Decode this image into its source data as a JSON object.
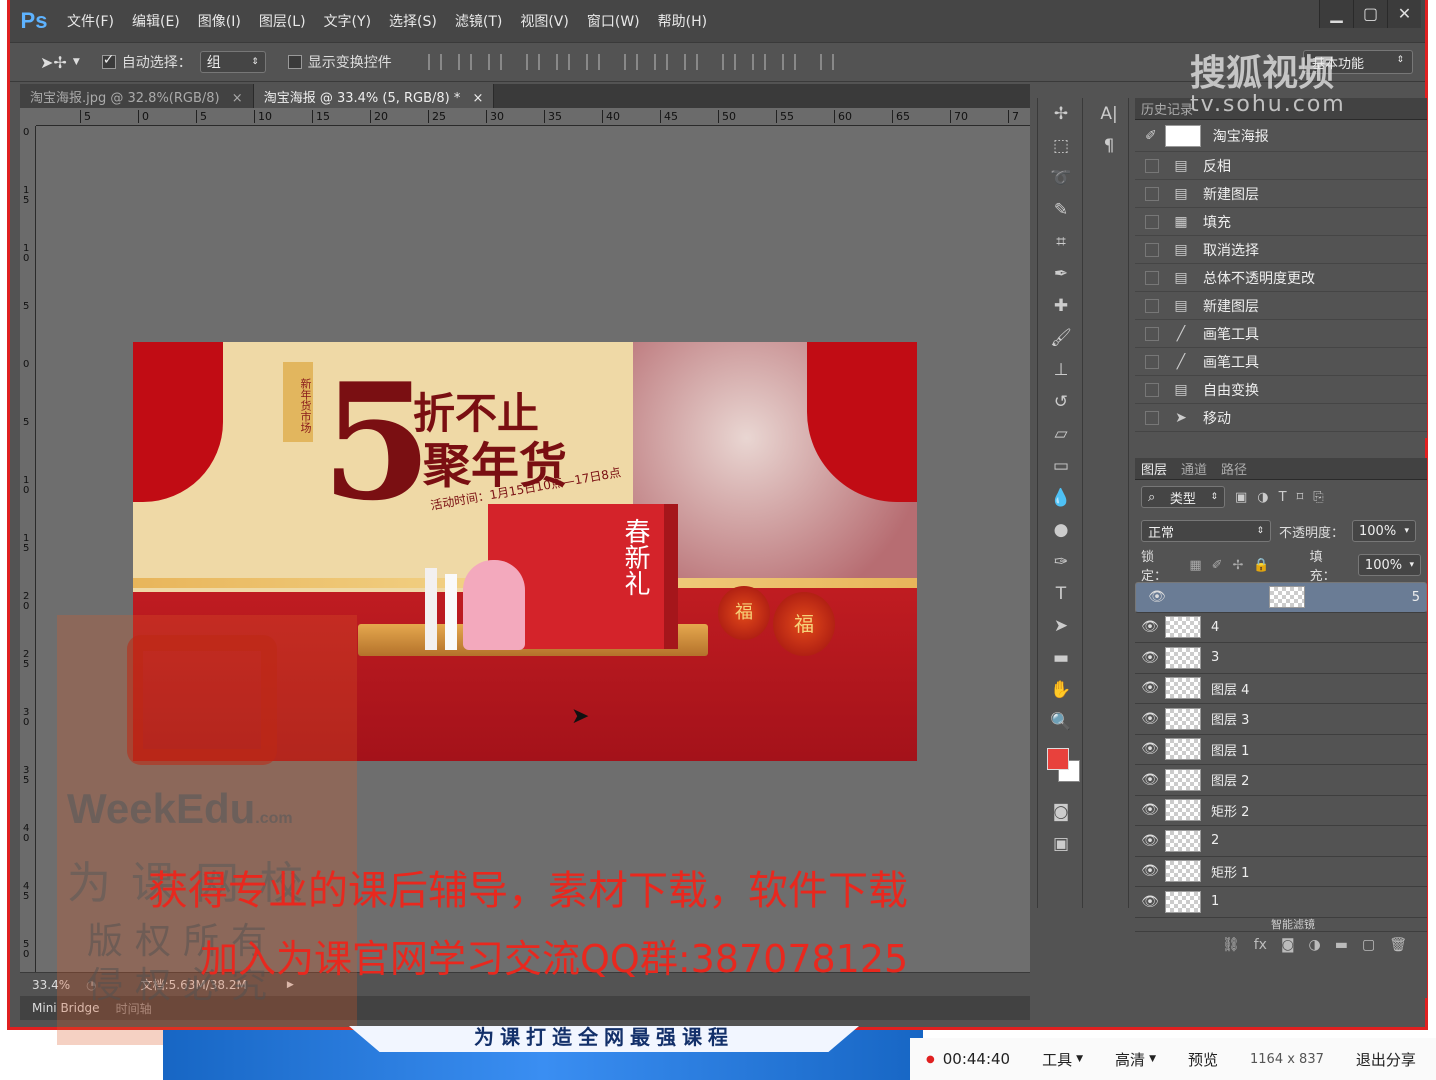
{
  "app": {
    "logo": "Ps"
  },
  "menu": [
    "文件(F)",
    "编辑(E)",
    "图像(I)",
    "图层(L)",
    "文字(Y)",
    "选择(S)",
    "滤镜(T)",
    "视图(V)",
    "窗口(W)",
    "帮助(H)"
  ],
  "window_controls": [
    "minimize",
    "maximize",
    "close"
  ],
  "options": {
    "auto_select_label": "自动选择：",
    "auto_select_value": "组",
    "show_transform_label": "显示变换控件",
    "workspace": "基本功能"
  },
  "tabs": [
    {
      "label": "淘宝海报.jpg @ 32.8%(RGB/8)",
      "active": false
    },
    {
      "label": "淘宝海报 @ 33.4% (5, RGB/8) *",
      "active": true
    }
  ],
  "ruler_h": [
    "5",
    "0",
    "5",
    "10",
    "15",
    "20",
    "25",
    "30",
    "35",
    "40",
    "45",
    "50",
    "55",
    "60",
    "65",
    "70",
    "7"
  ],
  "ruler_v": [
    "0",
    "1 5",
    "1 0",
    "5",
    "0",
    "5",
    "1 0",
    "1 5",
    "2 0",
    "2 5",
    "3 0",
    "3 5",
    "4 0",
    "4 5",
    "5 0"
  ],
  "poster": {
    "headline1": "5",
    "headline2": "折不止",
    "headline3": "聚年货",
    "activity": "活动时间：1月15日10点—17日8点",
    "side_tag": "新年货市场",
    "box_text": "春新礼",
    "bag_text": "福"
  },
  "status": {
    "zoom": "33.4%",
    "doc": "文档:5.63M/38.2M"
  },
  "bottom_tabs": [
    "Mini Bridge",
    "时间轴"
  ],
  "history": {
    "title": "历史记录",
    "snapshot": "淘宝海报",
    "items": [
      {
        "label": "反相",
        "icon": "doc-icon"
      },
      {
        "label": "新建图层",
        "icon": "doc-icon"
      },
      {
        "label": "填充",
        "icon": "fill-icon"
      },
      {
        "label": "取消选择",
        "icon": "doc-icon"
      },
      {
        "label": "总体不透明度更改",
        "icon": "doc-icon"
      },
      {
        "label": "新建图层",
        "icon": "doc-icon"
      },
      {
        "label": "画笔工具",
        "icon": "brush-icon"
      },
      {
        "label": "画笔工具",
        "icon": "brush-icon"
      },
      {
        "label": "自由变换",
        "icon": "doc-icon"
      },
      {
        "label": "移动",
        "icon": "move-icon"
      }
    ]
  },
  "layers_panel": {
    "tabs": [
      "图层",
      "通道",
      "路径"
    ],
    "filter": "类型",
    "blend_mode": "正常",
    "opacity_label": "不透明度：",
    "opacity": "100%",
    "lock_label": "锁定：",
    "fill_label": "填充：",
    "fill": "100%",
    "layers": [
      {
        "name": "5",
        "selected": true
      },
      {
        "name": "4",
        "selected": false
      },
      {
        "name": "3",
        "selected": false
      },
      {
        "name": "图层 4",
        "selected": false
      },
      {
        "name": "图层 3",
        "selected": false
      },
      {
        "name": "图层 1",
        "selected": false
      },
      {
        "name": "图层 2",
        "selected": false
      },
      {
        "name": "矩形 2",
        "selected": false
      },
      {
        "name": "2",
        "selected": false
      },
      {
        "name": "矩形 1",
        "selected": false
      },
      {
        "name": "1",
        "selected": false
      }
    ],
    "partial_row": "智能滤镜"
  },
  "overlay": {
    "line1": "获得专业的课后辅导，素材下载，软件下载",
    "line2": "加入为课官网学习交流QQ群:387078125",
    "brand": "WeekEdu",
    "brand_suffix": ".com",
    "brand_cn": "为课网校",
    "copyright": "版权所有 侵权必究",
    "sohu": "搜狐视频",
    "sohu_url": "tv.sohu.com",
    "banner": "为课打造全网最强课程"
  },
  "taskbar": {
    "time": "00:44:40",
    "tools": "工具",
    "quality": "高清",
    "preview": "预览",
    "resolution": "1164 x 837",
    "exit": "退出分享"
  },
  "colors": {
    "fg": "#e8413c",
    "bg": "#ffffff",
    "accent_red": "#e02020"
  }
}
